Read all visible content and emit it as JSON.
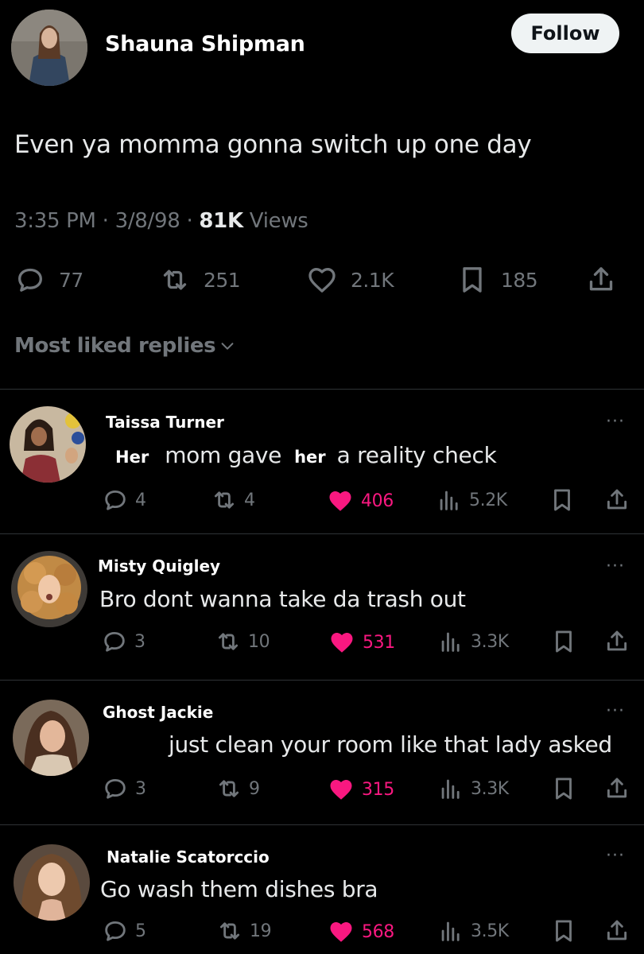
{
  "tweet": {
    "author": "Shauna Shipman",
    "follow_label": "Follow",
    "text": "Even ya momma gonna switch up one day",
    "time": "3:35 PM",
    "date": "3/8/98",
    "views_count": "81K",
    "views_label": "Views",
    "separator": "·",
    "stats": {
      "replies": "77",
      "reposts": "251",
      "likes": "2.1K",
      "bookmarks": "185"
    }
  },
  "replies_header": "Most liked replies",
  "replies": [
    {
      "name": "Taissa Turner",
      "text_parts": [
        "Her",
        "mom gave",
        "her",
        "a reality check"
      ],
      "replies": "4",
      "reposts": "4",
      "likes": "406",
      "views": "5.2K"
    },
    {
      "name": "Misty Quigley",
      "text": "Bro dont wanna take da trash out",
      "replies": "3",
      "reposts": "10",
      "likes": "531",
      "views": "3.3K"
    },
    {
      "name": "Ghost Jackie",
      "text": "just clean your room like that lady asked",
      "replies": "3",
      "reposts": "9",
      "likes": "315",
      "views": "3.3K"
    },
    {
      "name": "Natalie Scatorccio",
      "text": "Go wash them dishes bra",
      "replies": "5",
      "reposts": "19",
      "likes": "568",
      "views": "3.5K"
    }
  ],
  "more_glyph": "···",
  "colors": {
    "background": "#000000",
    "text": "#e7e9ea",
    "muted": "#71767b",
    "like": "#f91880",
    "divider": "#2f3336"
  },
  "icons": {
    "reply": "reply-bubble-icon",
    "repost": "repost-icon",
    "like": "heart-icon",
    "bookmark": "bookmark-icon",
    "share": "share-icon",
    "views": "views-bars-icon",
    "more": "more-dots-icon",
    "chevron": "chevron-down-icon"
  }
}
